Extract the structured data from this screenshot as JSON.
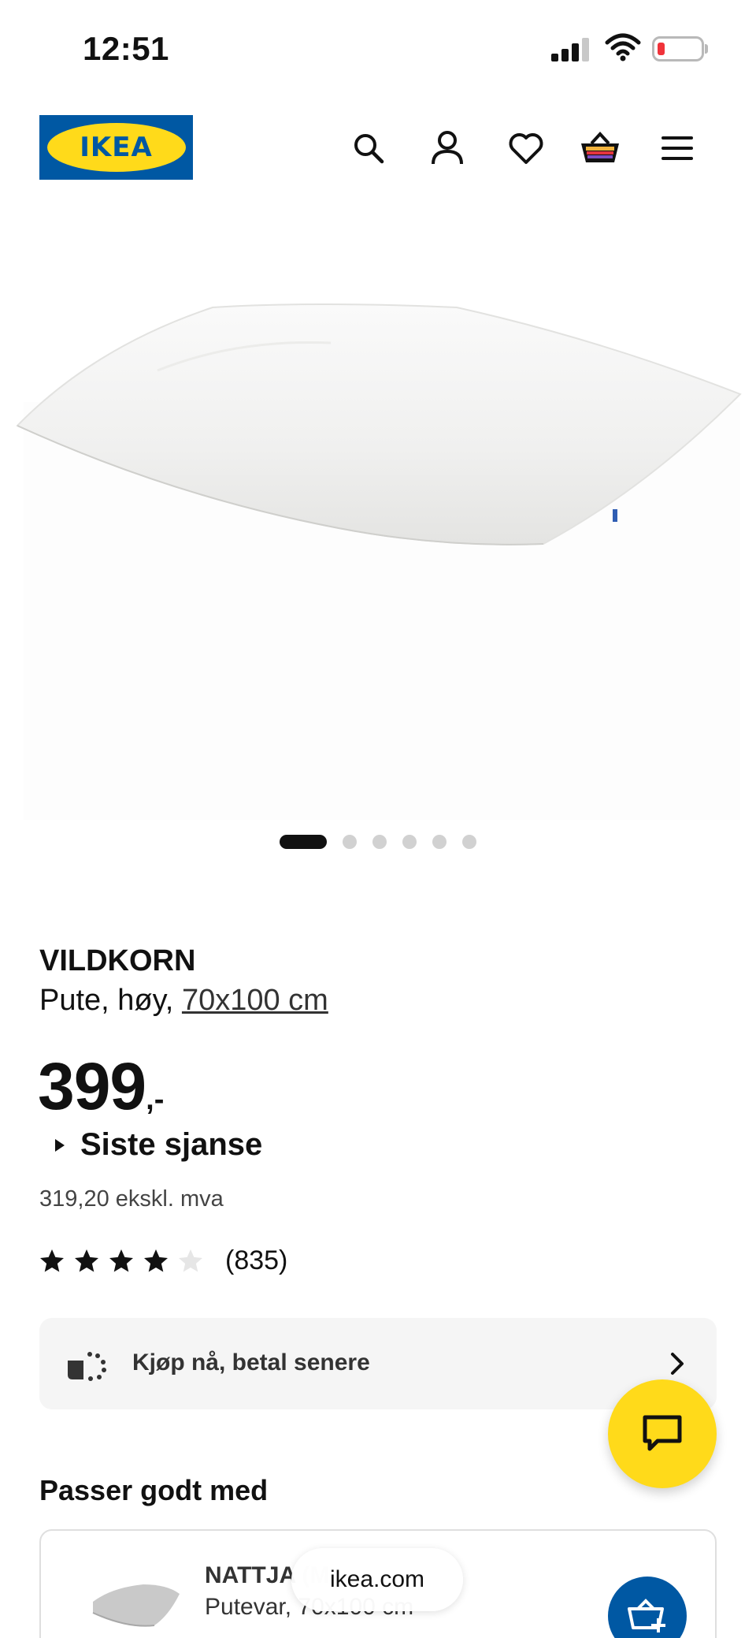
{
  "status_bar": {
    "time": "12:51"
  },
  "header": {
    "logo_text": "IKEA",
    "icons": [
      "search-icon",
      "account-icon",
      "heart-icon",
      "basket-icon",
      "menu-icon"
    ]
  },
  "gallery": {
    "image_count": 6,
    "active_index": 0
  },
  "product": {
    "name": "VILDKORN",
    "desc_prefix": "Pute, høy, ",
    "size": "70x100 cm",
    "price": "399",
    "price_suffix": ",-",
    "last_chance": "Siste sjanse",
    "ex_vat": "319,20 ekskl. mva",
    "rating_stars": 4,
    "rating_max": 5,
    "review_count": "(835)"
  },
  "paylater": {
    "label": "Kjøp nå, betal senere"
  },
  "recommend": {
    "title": "Passer godt med",
    "item": {
      "name": "NATTJA",
      "name_suffix": "(M",
      "desc": "Putevar, 70x100 cm"
    }
  },
  "browser": {
    "url": "ikea.com"
  },
  "colors": {
    "ikea_blue": "#0058a3",
    "ikea_yellow": "#ffda1a"
  }
}
